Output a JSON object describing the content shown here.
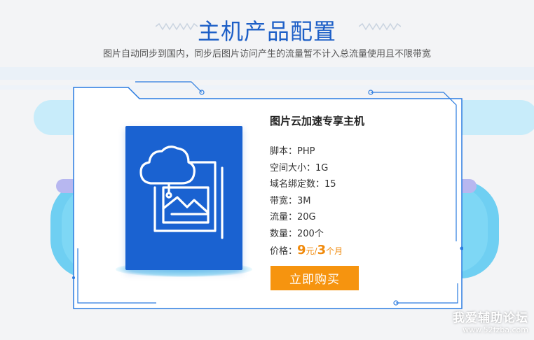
{
  "header": {
    "title": "主机产品配置",
    "subtitle": "图片自动同步到国内，同步后图片访问产生的流量暂不计入总流量使用且不限带宽"
  },
  "product": {
    "name": "图片云加速专享主机",
    "image_icon": "cloud-photo-icon",
    "specs": [
      "脚本：PHP",
      "空间大小：1G",
      "域名绑定数：15",
      "带宽：3M",
      "流量：20G",
      "数量：200个"
    ],
    "price": {
      "label": "价格：",
      "amount": "9",
      "unit": "元/",
      "period_amount": "3",
      "period_unit": "个月"
    },
    "buy_label": "立即购买"
  },
  "watermark": {
    "text": "我爱辅助论坛",
    "url": "www.52fzba.com"
  },
  "colors": {
    "brand_blue": "#1d5fc7",
    "image_blue": "#1a62d1",
    "accent_orange": "#f6940f"
  }
}
